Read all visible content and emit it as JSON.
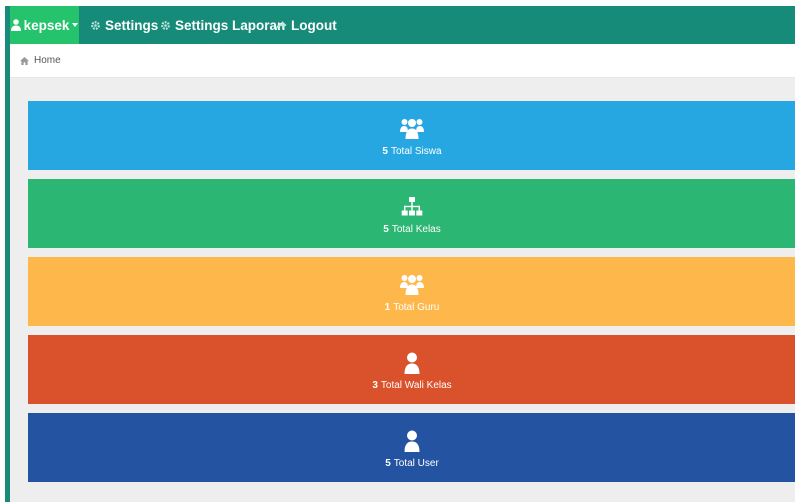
{
  "navbar": {
    "user_label": "kepsek",
    "items": [
      {
        "label": "Settings",
        "icon": "gear-icon"
      },
      {
        "label": "Settings Laporan",
        "icon": "gear-icon"
      },
      {
        "label": "Logout",
        "icon": "share-arrow-icon"
      }
    ],
    "bg_color": "#168b79",
    "user_bg_color": "#24c36c"
  },
  "breadcrumb": {
    "icon": "home-icon",
    "label": "Home"
  },
  "tiles": [
    {
      "count": "5",
      "label": "Total Siswa",
      "icon": "group-icon",
      "color": "#27a7e2"
    },
    {
      "count": "5",
      "label": "Total Kelas",
      "icon": "sitemap-icon",
      "color": "#2bb673"
    },
    {
      "count": "1",
      "label": "Total Guru",
      "icon": "group-icon",
      "color": "#fdb74b"
    },
    {
      "count": "3",
      "label": "Total Wali Kelas",
      "icon": "user-icon",
      "color": "#d9522c"
    },
    {
      "count": "5",
      "label": "Total User",
      "icon": "user-icon",
      "color": "#2353a1"
    }
  ]
}
